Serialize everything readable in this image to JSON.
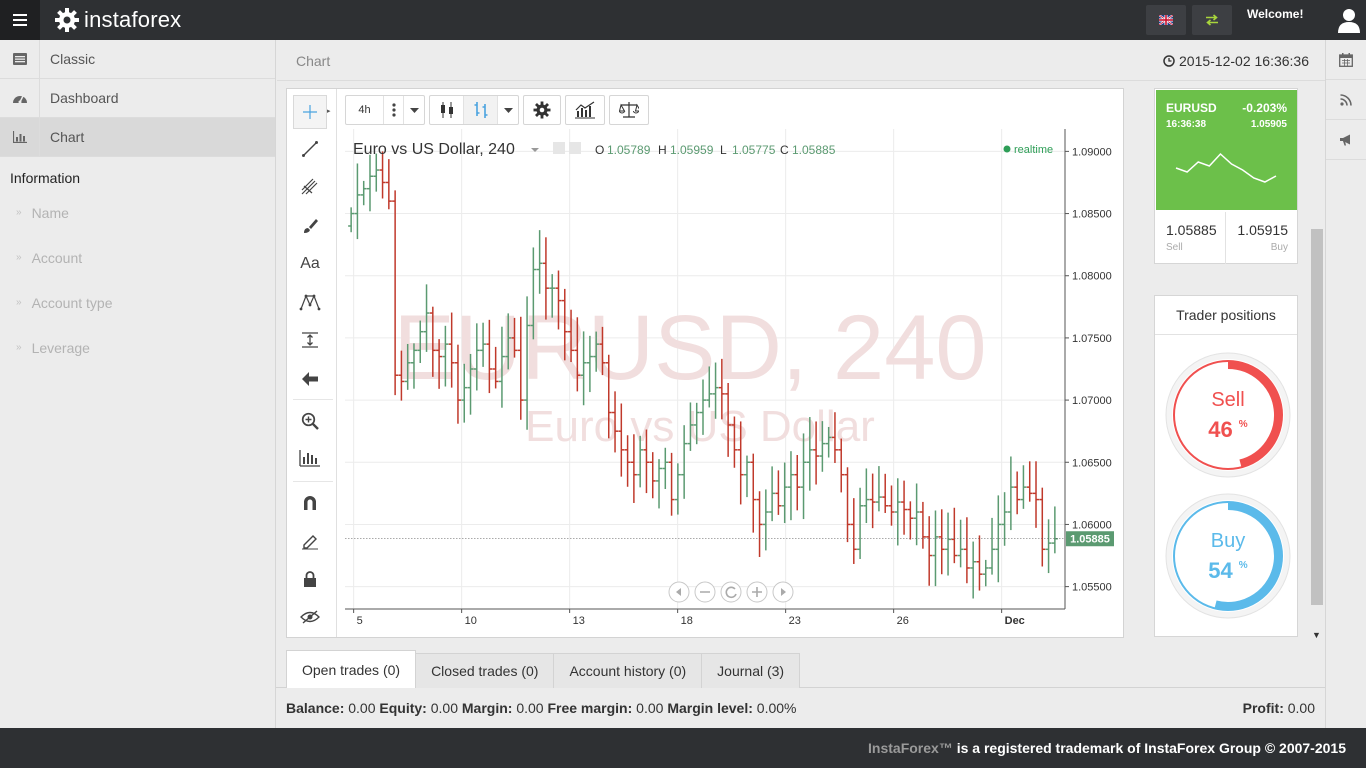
{
  "brand": {
    "logo_text": "instaforex"
  },
  "header": {
    "welcome": "Welcome!",
    "page_title": "Chart",
    "clock": "2015-12-02 16:36:36"
  },
  "sidebar": {
    "items": [
      {
        "label": "Classic",
        "icon": "list-icon"
      },
      {
        "label": "Dashboard",
        "icon": "dashboard-icon"
      },
      {
        "label": "Chart",
        "icon": "chart-icon",
        "active": true
      }
    ],
    "info_title": "Information",
    "info_rows": [
      "Name",
      "Account",
      "Account type",
      "Leverage"
    ]
  },
  "toolbar": {
    "timeframe": "4h"
  },
  "chart_data": {
    "type": "ohlc",
    "title": "Euro vs US Dollar, 240",
    "watermark_symbol": "EURUSD, 240",
    "watermark_name": "Euro vs US Dollar",
    "ohlc_labels": {
      "o": "O",
      "h": "H",
      "l": "L",
      "c": "C"
    },
    "ohlc_values": {
      "o": "1.05789",
      "h": "1.05959",
      "l": "1.05775",
      "c": "1.05885"
    },
    "realtime_label": "realtime",
    "last_price": "1.05885",
    "last_price_value": 1.05885,
    "y_ticks": [
      "1.09000",
      "1.08500",
      "1.08000",
      "1.07500",
      "1.07000",
      "1.06500",
      "1.06000",
      "1.05500"
    ],
    "ylim": [
      1.0532,
      1.0918
    ],
    "x_ticks": [
      "5",
      "10",
      "13",
      "18",
      "23",
      "26",
      "Dec"
    ],
    "colors": {
      "up": "#5b9a71",
      "down": "#c0392b"
    },
    "close_path": [
      1.085,
      1.0865,
      1.087,
      1.088,
      1.0885,
      1.0875,
      1.086,
      1.072,
      1.0715,
      1.073,
      1.074,
      1.0755,
      1.077,
      1.074,
      1.0735,
      1.0745,
      1.073,
      1.07,
      1.071,
      1.0725,
      1.074,
      1.0745,
      1.0725,
      1.0715,
      1.0735,
      1.075,
      1.074,
      1.07,
      1.076,
      1.0805,
      1.081,
      1.079,
      1.079,
      1.078,
      1.0755,
      1.074,
      1.072,
      1.073,
      1.0735,
      1.0745,
      1.073,
      1.069,
      1.0675,
      1.066,
      1.065,
      1.064,
      1.066,
      1.065,
      1.0635,
      1.0645,
      1.065,
      1.062,
      1.064,
      1.0665,
      1.068,
      1.069,
      1.07,
      1.0705,
      1.071,
      1.0705,
      1.068,
      1.066,
      1.064,
      1.065,
      1.062,
      1.06,
      1.061,
      1.0625,
      1.0615,
      1.063,
      1.064,
      1.063,
      1.065,
      1.066,
      1.0655,
      1.0665,
      1.067,
      1.066,
      1.064,
      1.06,
      1.058,
      1.0615,
      1.062,
      1.0618,
      1.0622,
      1.0615,
      1.061,
      1.0618,
      1.0612,
      1.0605,
      1.061,
      1.059,
      1.0575,
      1.059,
      1.058,
      1.0588,
      1.0575,
      1.058,
      1.0565,
      1.057,
      1.056,
      1.0565,
      1.058,
      1.06,
      1.061,
      1.063,
      1.062,
      1.063,
      1.0625,
      1.062,
      1.058,
      1.0585,
      1.05885
    ]
  },
  "trade_widget": {
    "symbol": "EURUSD",
    "change": "-0.203%",
    "time": "16:36:38",
    "price": "1.05905",
    "sell_price": "1.05885",
    "sell_label": "Sell",
    "buy_price": "1.05915",
    "buy_label": "Buy",
    "spark": [
      0.4,
      0.3,
      0.55,
      0.45,
      0.75,
      0.5,
      0.35,
      0.15,
      0.05,
      0.2
    ]
  },
  "trader_positions": {
    "title": "Trader positions",
    "sell_label": "Sell",
    "sell_pct": 46,
    "buy_label": "Buy",
    "buy_pct": 54,
    "pct_sign": "%"
  },
  "tabs": [
    {
      "label": "Open trades (0)",
      "active": true
    },
    {
      "label": "Closed trades (0)"
    },
    {
      "label": "Account history (0)"
    },
    {
      "label": "Journal (3)"
    }
  ],
  "balance": {
    "balance_label": "Balance:",
    "balance": "0.00",
    "equity_label": "Equity:",
    "equity": "0.00",
    "margin_label": "Margin:",
    "margin": "0.00",
    "free_margin_label": "Free margin:",
    "free_margin": "0.00",
    "margin_level_label": "Margin level:",
    "margin_level": "0.00%",
    "profit_label": "Profit:",
    "profit": "0.00"
  },
  "footer": {
    "brand": "InstaForex™",
    "text": " is a registered trademark of InstaForex Group © 2007-2015"
  },
  "colors": {
    "topbar": "#2e3033",
    "widget_green": "#6cc04a",
    "sell_red": "#f0504f",
    "buy_blue": "#5bbaea"
  }
}
